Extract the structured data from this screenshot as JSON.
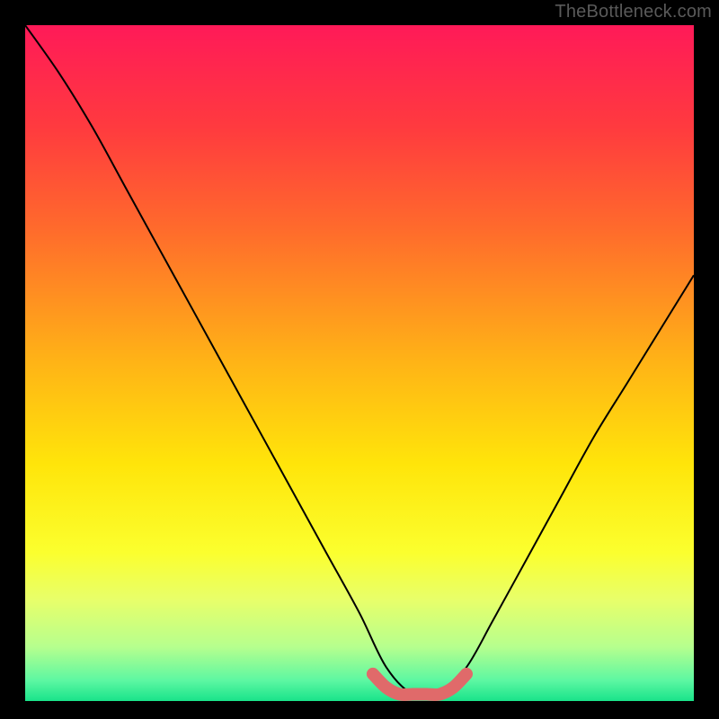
{
  "attribution": "TheBottleneck.com",
  "chart_data": {
    "type": "line",
    "title": "",
    "xlabel": "",
    "ylabel": "",
    "xlim": [
      0,
      100
    ],
    "ylim": [
      0,
      100
    ],
    "series": [
      {
        "name": "bottleneck-curve",
        "x": [
          0,
          5,
          10,
          15,
          20,
          25,
          30,
          35,
          40,
          45,
          50,
          54,
          58,
          62,
          66,
          70,
          75,
          80,
          85,
          90,
          95,
          100
        ],
        "values": [
          100,
          93,
          85,
          76,
          67,
          58,
          49,
          40,
          31,
          22,
          13,
          5,
          1,
          1,
          5,
          12,
          21,
          30,
          39,
          47,
          55,
          63
        ]
      },
      {
        "name": "optimal-zone",
        "x": [
          52,
          54,
          56,
          58,
          60,
          62,
          64,
          66
        ],
        "values": [
          4,
          2,
          1,
          1,
          1,
          1,
          2,
          4
        ]
      }
    ],
    "gradient_stops": [
      {
        "offset": 0,
        "color": "#ff1a58"
      },
      {
        "offset": 15,
        "color": "#ff3a3f"
      },
      {
        "offset": 30,
        "color": "#ff6a2c"
      },
      {
        "offset": 50,
        "color": "#ffb416"
      },
      {
        "offset": 65,
        "color": "#ffe50a"
      },
      {
        "offset": 78,
        "color": "#fbff2e"
      },
      {
        "offset": 85,
        "color": "#e8ff6a"
      },
      {
        "offset": 92,
        "color": "#b6ff8e"
      },
      {
        "offset": 97,
        "color": "#5cf7a2"
      },
      {
        "offset": 100,
        "color": "#19e38a"
      }
    ],
    "colors": {
      "frame": "#000000",
      "curve": "#000000",
      "optimal_zone": "#e06a6a"
    }
  }
}
